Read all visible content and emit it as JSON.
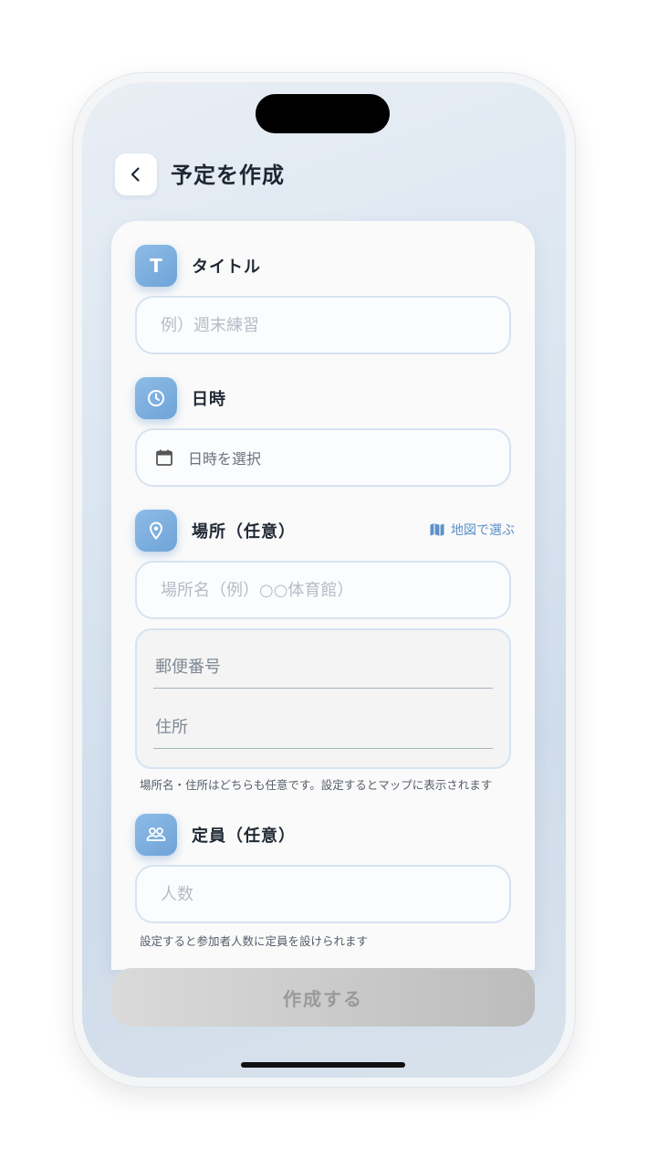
{
  "header": {
    "title": "予定を作成",
    "back_icon": "chevron-left-icon"
  },
  "form": {
    "title_section": {
      "label": "タイトル",
      "icon": "title-t-icon",
      "icon_glyph": "T",
      "placeholder": "例）週末練習"
    },
    "datetime_section": {
      "label": "日時",
      "icon": "clock-icon",
      "field_text": "日時を選択",
      "field_icon": "calendar-icon"
    },
    "location_section": {
      "label": "場所（任意）",
      "icon": "location-pin-icon",
      "map_link": "地図で選ぶ",
      "map_icon": "map-icon",
      "place_placeholder": "場所名（例）○○体育館）",
      "postal_placeholder": "郵便番号",
      "address_placeholder": "住所",
      "hint": "場所名・住所はどちらも任意です。設定するとマップに表示されます"
    },
    "capacity_section": {
      "label": "定員（任意）",
      "icon": "people-icon",
      "placeholder": "人数",
      "hint": "設定すると参加者人数に定員を設けられます"
    }
  },
  "submit": {
    "label": "作成する",
    "enabled": false
  },
  "colors": {
    "accent": "#72a6d9",
    "link": "#5b90c8",
    "field_border": "#d6e3f0",
    "button_disabled": "#c8c8c8"
  }
}
